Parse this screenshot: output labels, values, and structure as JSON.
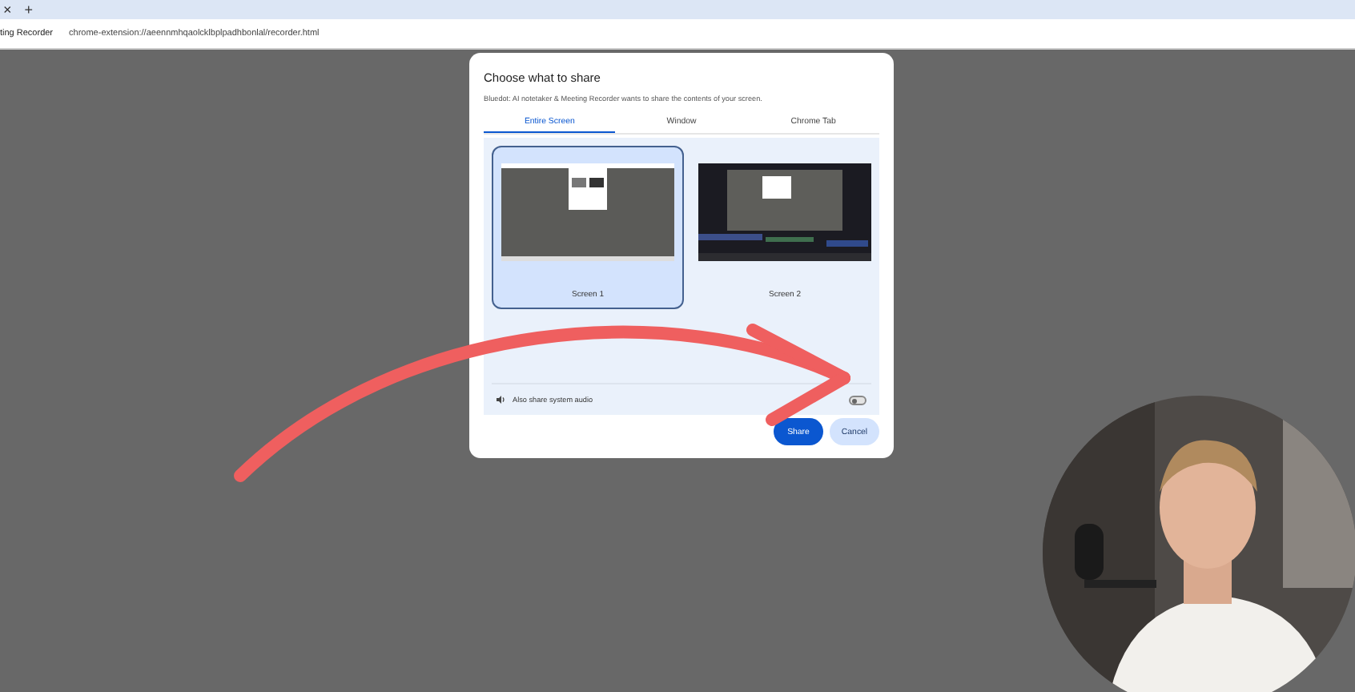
{
  "browser": {
    "tab_close": "×",
    "new_tab": "+",
    "tab_title": "ting Recorder",
    "url": "chrome-extension://aeennmhqaolcklbplpadhbonlal/recorder.html"
  },
  "dialog": {
    "title": "Choose what to share",
    "subtitle": "Bluedot: AI notetaker & Meeting Recorder wants to share the contents of your screen.",
    "tabs": [
      {
        "label": "Entire Screen",
        "selected": true
      },
      {
        "label": "Window",
        "selected": false
      },
      {
        "label": "Chrome Tab",
        "selected": false
      }
    ],
    "screens": [
      {
        "label": "Screen 1",
        "selected": true
      },
      {
        "label": "Screen 2",
        "selected": false
      }
    ],
    "audio": {
      "label": "Also share system audio",
      "on": false
    },
    "buttons": [
      {
        "label": "Share",
        "kind": "primary"
      },
      {
        "label": "Cancel",
        "kind": "secondary"
      }
    ]
  }
}
